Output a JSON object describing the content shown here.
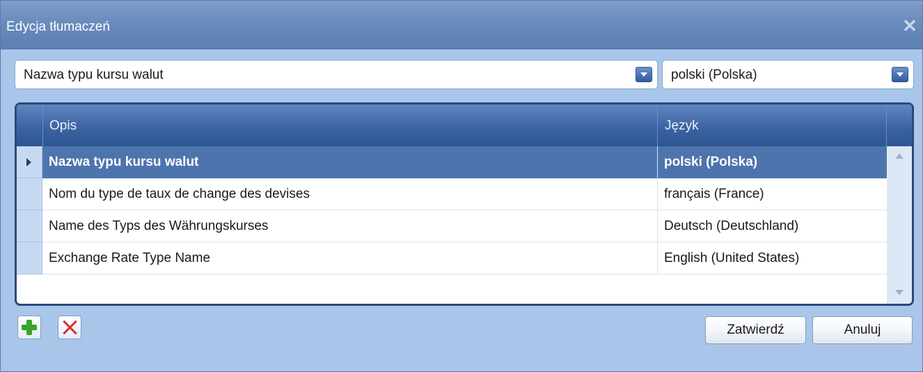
{
  "window": {
    "title": "Edycja tłumaczeń",
    "close_label": "✕"
  },
  "filters": {
    "description": {
      "value": "Nazwa typu kursu walut"
    },
    "language": {
      "value": "polski (Polska)"
    }
  },
  "grid": {
    "columns": [
      "Opis",
      "Język"
    ],
    "rows": [
      {
        "description": "Nazwa typu kursu walut",
        "language": "polski (Polska)",
        "selected": true
      },
      {
        "description": "Nom du type de taux de change des devises",
        "language": "français (France)",
        "selected": false
      },
      {
        "description": "Name des Typs des Währungskurses",
        "language": "Deutsch (Deutschland)",
        "selected": false
      },
      {
        "description": "Exchange Rate Type Name",
        "language": "English (United States)",
        "selected": false
      }
    ]
  },
  "toolbar": {
    "add_icon": "plus-icon",
    "delete_icon": "x-icon"
  },
  "buttons": {
    "confirm_label": "Zatwierdź",
    "cancel_label": "Anuluj"
  },
  "colors": {
    "accent": "#2b4a78",
    "selected_row": "#4e74ad",
    "background": "#a9c6ea",
    "add": "#38a32a",
    "delete": "#d8302b"
  }
}
